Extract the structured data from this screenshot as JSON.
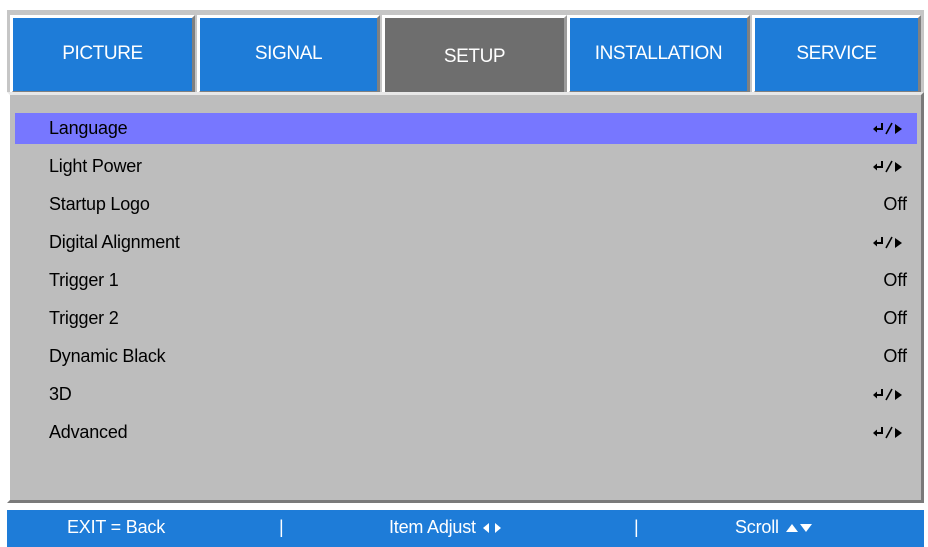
{
  "tabs": [
    {
      "label": "PICTURE"
    },
    {
      "label": "SIGNAL"
    },
    {
      "label": "SETUP"
    },
    {
      "label": "INSTALLATION"
    },
    {
      "label": "SERVICE"
    }
  ],
  "selected_tab": "SETUP",
  "menu": {
    "items": [
      {
        "label": "Language",
        "value_type": "enter-icon",
        "selected": true
      },
      {
        "label": "Light Power",
        "value_type": "enter-icon"
      },
      {
        "label": "Startup Logo",
        "value": "Off"
      },
      {
        "label": "Digital Alignment",
        "value_type": "enter-icon"
      },
      {
        "label": "Trigger 1",
        "value": "Off"
      },
      {
        "label": "Trigger 2",
        "value": "Off"
      },
      {
        "label": "Dynamic Black",
        "value": "Off"
      },
      {
        "label": "3D",
        "value_type": "enter-icon"
      },
      {
        "label": "Advanced",
        "value_type": "enter-icon"
      }
    ]
  },
  "hints": {
    "exit": "EXIT = Back",
    "separator": "|",
    "adjust": "Item Adjust",
    "scroll": "Scroll"
  },
  "colors": {
    "tab_blue": "#1e7cd8",
    "tab_selected": "#6e6e6e",
    "panel_gray": "#bdbdbd",
    "highlight": "#7777ff"
  }
}
